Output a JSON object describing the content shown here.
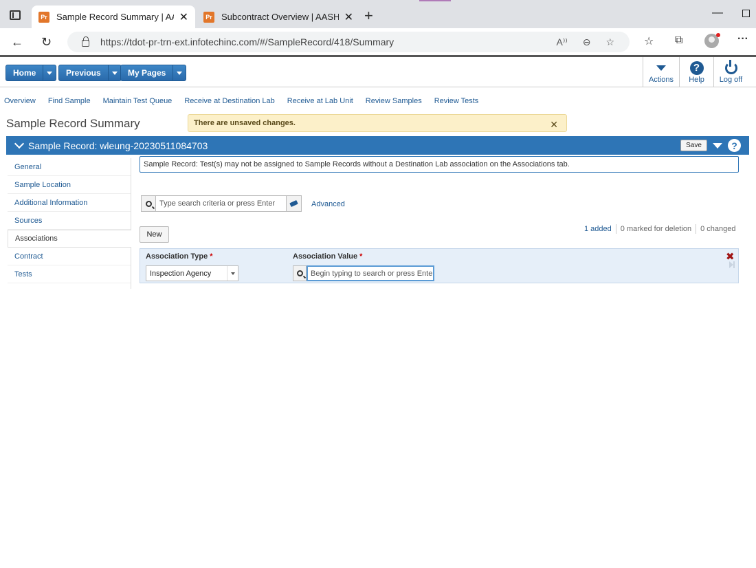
{
  "browser": {
    "tabs": [
      {
        "favicon": "Pr",
        "title": "Sample Record Summary | AASHTOWare Project",
        "active": true
      },
      {
        "favicon": "Pr",
        "title": "Subcontract Overview | AASHTOWare Project",
        "active": false
      }
    ],
    "url": "https://tdot-pr-trn-ext.infotechinc.com/#/SampleRecord/418/Summary",
    "read_aloud_glyph": "A))"
  },
  "header": {
    "home_label": "Home",
    "previous_label": "Previous",
    "mypages_label": "My Pages",
    "actions_label": "Actions",
    "help_label": "Help",
    "logoff_label": "Log off"
  },
  "subnav": [
    "Overview",
    "Find Sample",
    "Maintain Test Queue",
    "Receive at Destination Lab",
    "Receive at Lab Unit",
    "Review Samples",
    "Review Tests"
  ],
  "page": {
    "title": "Sample Record Summary",
    "unsaved_message": "There are unsaved changes."
  },
  "panel": {
    "title": "Sample Record: wleung-20230511084703",
    "save_label": "Save"
  },
  "sidenav": [
    {
      "label": "General",
      "active": false
    },
    {
      "label": "Sample Location",
      "active": false
    },
    {
      "label": "Additional Information",
      "active": false
    },
    {
      "label": "Sources",
      "active": false
    },
    {
      "label": "Associations",
      "active": true
    },
    {
      "label": "Contract",
      "active": false
    },
    {
      "label": "Tests",
      "active": false
    }
  ],
  "main": {
    "info_message": "Sample Record: Test(s) may not be assigned to Sample Records without a Destination Lab association on the Associations tab.",
    "search_placeholder": "Type search criteria or press Enter",
    "advanced_label": "Advanced",
    "new_label": "New",
    "counts": {
      "added": "1 added",
      "deleted": "0 marked for deletion",
      "changed": "0 changed"
    },
    "row": {
      "type_label": "Association Type",
      "value_label": "Association Value",
      "required_mark": "*",
      "type_value": "Inspection Agency",
      "value_placeholder": "Begin typing to search or press Enter"
    }
  },
  "colors": {
    "brand": "#2e75b6",
    "link": "#1f5a93",
    "warning_bg": "#fcf0c9",
    "required": "#cc0000"
  }
}
